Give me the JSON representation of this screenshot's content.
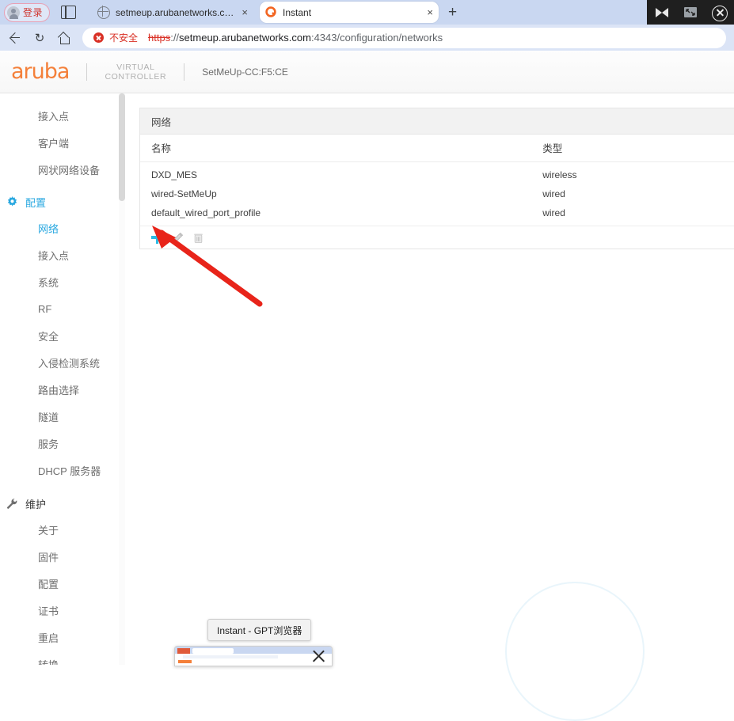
{
  "browser": {
    "account_button": {
      "label": "登录",
      "icon": "avatar-icon",
      "color": "#d0342c"
    },
    "sidepanel_icon": "side-panel-icon",
    "tabs": [
      {
        "title": "setmeup.arubanetworks.com",
        "favicon": "globe-icon",
        "active": false,
        "close": "×"
      },
      {
        "title": "Instant",
        "favicon": "aruba-instant-icon",
        "active": true,
        "close": "×"
      }
    ],
    "new_tab_label": "+",
    "window_controls": [
      {
        "name": "collapse-icon",
        "glyph": "collapse"
      },
      {
        "name": "restore-icon",
        "glyph": "restore"
      },
      {
        "name": "close-icon",
        "glyph": "close"
      }
    ],
    "nav": {
      "back": "back-arrow-icon",
      "reload": "↻",
      "home": "home-icon"
    },
    "omnibox": {
      "security_label": "不安全",
      "security_icon": "not-secure-icon",
      "url_scheme": "https",
      "url_separator": "://",
      "url_domain": "setmeup.arubanetworks.com",
      "url_rest": ":4343/configuration/networks",
      "full_url": "https://setmeup.arubanetworks.com:4343/configuration/networks"
    }
  },
  "app": {
    "brand": "aruba",
    "virtual_controller_line1": "VIRTUAL",
    "virtual_controller_line2": "CONTROLLER",
    "controller_name": "SetMeUp-CC:F5:CE",
    "accent_color": "#29a8e0",
    "brand_color": "#f4803a"
  },
  "sidebar": {
    "top_items": [
      {
        "label": "接入点"
      },
      {
        "label": "客户端"
      },
      {
        "label": "网状网络设备"
      }
    ],
    "groups": [
      {
        "icon": "gear-icon",
        "label": "配置",
        "items": [
          {
            "label": "网络",
            "selected": true
          },
          {
            "label": "接入点",
            "selected": false
          },
          {
            "label": "系统",
            "selected": false
          },
          {
            "label": "RF",
            "selected": false
          },
          {
            "label": "安全",
            "selected": false
          },
          {
            "label": "入侵检测系统",
            "selected": false
          },
          {
            "label": "路由选择",
            "selected": false
          },
          {
            "label": "隧道",
            "selected": false
          },
          {
            "label": "服务",
            "selected": false
          },
          {
            "label": "DHCP 服务器",
            "selected": false
          }
        ]
      },
      {
        "icon": "wrench-icon",
        "label": "维护",
        "items": [
          {
            "label": "关于",
            "selected": false
          },
          {
            "label": "固件",
            "selected": false
          },
          {
            "label": "配置",
            "selected": false
          },
          {
            "label": "证书",
            "selected": false
          },
          {
            "label": "重启",
            "selected": false
          },
          {
            "label": "转换",
            "selected": false
          }
        ]
      }
    ]
  },
  "networks_panel": {
    "title": "网络",
    "columns": [
      "名称",
      "类型"
    ],
    "rows": [
      {
        "name": "DXD_MES",
        "type": "wireless"
      },
      {
        "name": "wired-SetMeUp",
        "type": "wired"
      },
      {
        "name": "default_wired_port_profile",
        "type": "wired"
      }
    ],
    "actions": [
      {
        "name": "add-network-button",
        "icon": "plus-icon",
        "color": "#2bbbe6"
      },
      {
        "name": "edit-network-button",
        "icon": "pencil-icon",
        "color": "#b8b8b8"
      },
      {
        "name": "delete-network-button",
        "icon": "trash-icon",
        "color": "#c6c6c6"
      }
    ]
  },
  "annotation": {
    "arrow_color": "#e8241a",
    "points_to": "add-network-button"
  },
  "taskbar_preview": {
    "tooltip": "Instant - GPT浏览器",
    "thumbnail_close": "×"
  }
}
